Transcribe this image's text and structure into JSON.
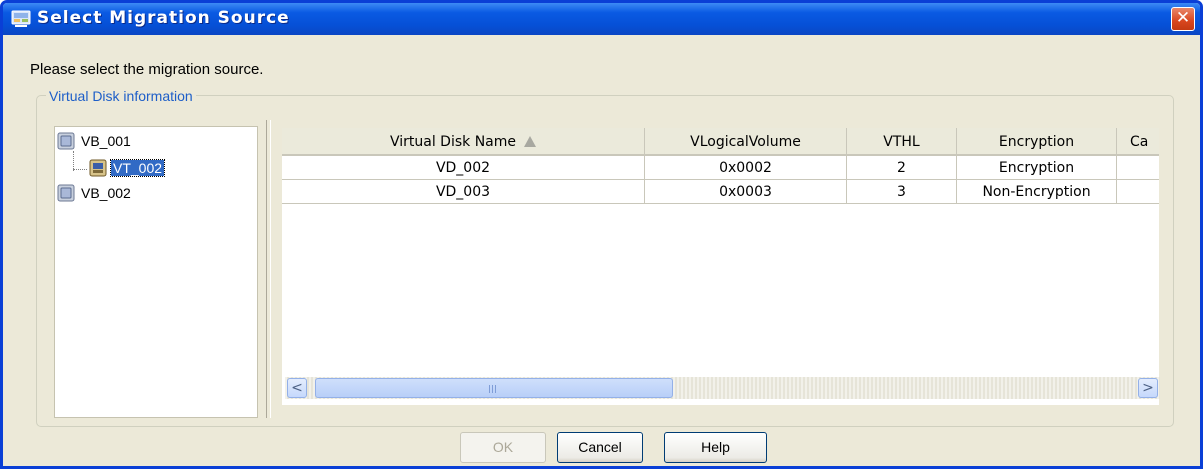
{
  "window": {
    "title": "Select Migration Source",
    "close_label": "✕"
  },
  "prompt": "Please select the migration source.",
  "group": {
    "legend": "Virtual Disk information"
  },
  "tree": {
    "items": [
      {
        "label": "VB_001",
        "icon": "disk-box-icon",
        "selected": false
      },
      {
        "label": "VT_002",
        "icon": "disk-volume-icon",
        "selected": true
      },
      {
        "label": "VB_002",
        "icon": "disk-box-icon",
        "selected": false
      }
    ]
  },
  "table": {
    "columns": [
      "Virtual Disk Name",
      "VLogicalVolume",
      "VTHL",
      "Encryption",
      "Ca"
    ],
    "sort": {
      "column": "Virtual Disk Name",
      "direction": "ascending"
    },
    "rows": [
      [
        "VD_002",
        "0x0002",
        "2",
        "Encryption",
        ""
      ],
      [
        "VD_003",
        "0x0003",
        "3",
        "Non-Encryption",
        ""
      ]
    ]
  },
  "scrollbar": {
    "left": "<",
    "right": ">"
  },
  "buttons": {
    "ok": "OK",
    "cancel": "Cancel",
    "help": "Help"
  },
  "colors": {
    "title_bar": "#0a5ae3",
    "selection": "#316ac5",
    "legend_text": "#1d5ec8"
  }
}
